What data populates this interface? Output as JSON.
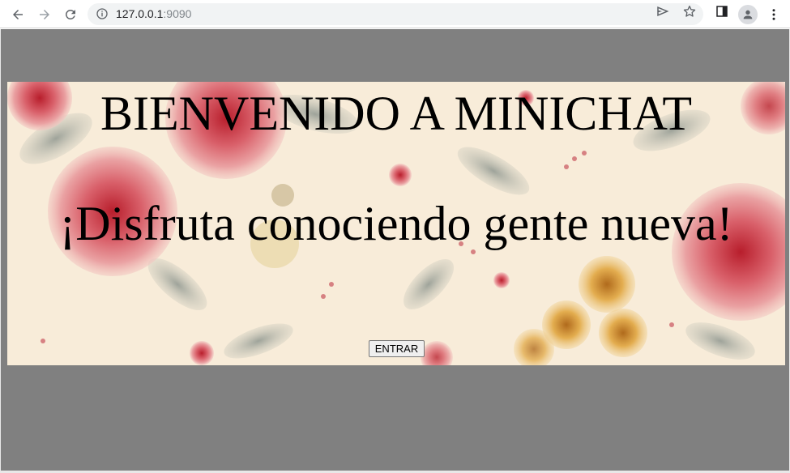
{
  "browser": {
    "url_host": "127.0.0.1",
    "url_port": ":9090",
    "icons": {
      "back": "arrow-left-icon",
      "forward": "arrow-right-icon",
      "reload": "reload-icon",
      "site_info": "info-icon",
      "send": "send-icon",
      "bookmark": "star-icon",
      "side_panel": "side-panel-icon",
      "profile": "avatar-icon",
      "menu": "kebab-menu-icon"
    }
  },
  "page": {
    "title": "BIENVENIDO A MINICHAT",
    "subtitle": "¡Disfruta conociendo gente nueva!",
    "enter_button": "ENTRAR",
    "background_color": "#808080",
    "banner_image": "floral-roses-background"
  }
}
